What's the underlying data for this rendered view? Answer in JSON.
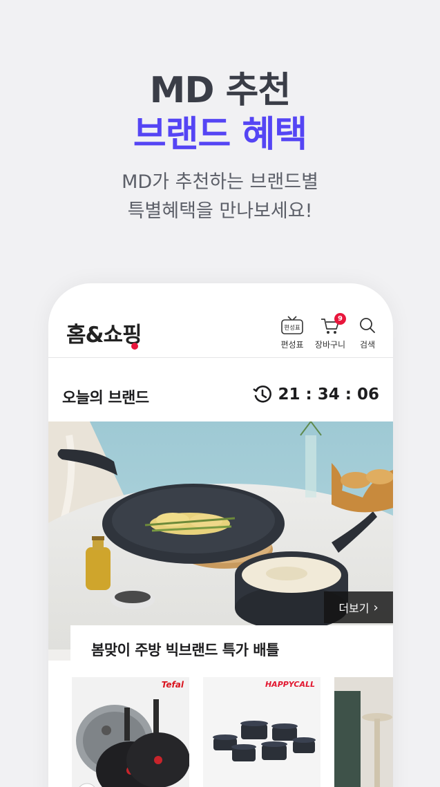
{
  "promo": {
    "title_line1": "MD 추천",
    "title_line2": "브랜드 혜택",
    "subtitle_line1": "MD가 추천하는 브랜드별",
    "subtitle_line2": "특별혜택을 만나보세요!"
  },
  "app": {
    "logo": "홈&쇼핑",
    "header_icons": [
      {
        "label": "편성표",
        "icon": "tv-schedule-icon",
        "icon_text": "편성표"
      },
      {
        "label": "장바구니",
        "icon": "cart-icon",
        "badge": "9"
      },
      {
        "label": "검색",
        "icon": "search-icon"
      }
    ]
  },
  "brand_section": {
    "title": "오늘의 브랜드",
    "timer": "21 : 34 : 06",
    "more_label": "더보기",
    "caption": "봄맞이 주방 빅브랜드 특가 배틀",
    "cards": [
      {
        "brand": "Tefal"
      },
      {
        "brand": "HAPPYCALL"
      },
      {
        "brand": ""
      }
    ]
  },
  "colors": {
    "accent": "#5545f4",
    "brand_red": "#e8163c",
    "background": "#f1f1f3"
  }
}
